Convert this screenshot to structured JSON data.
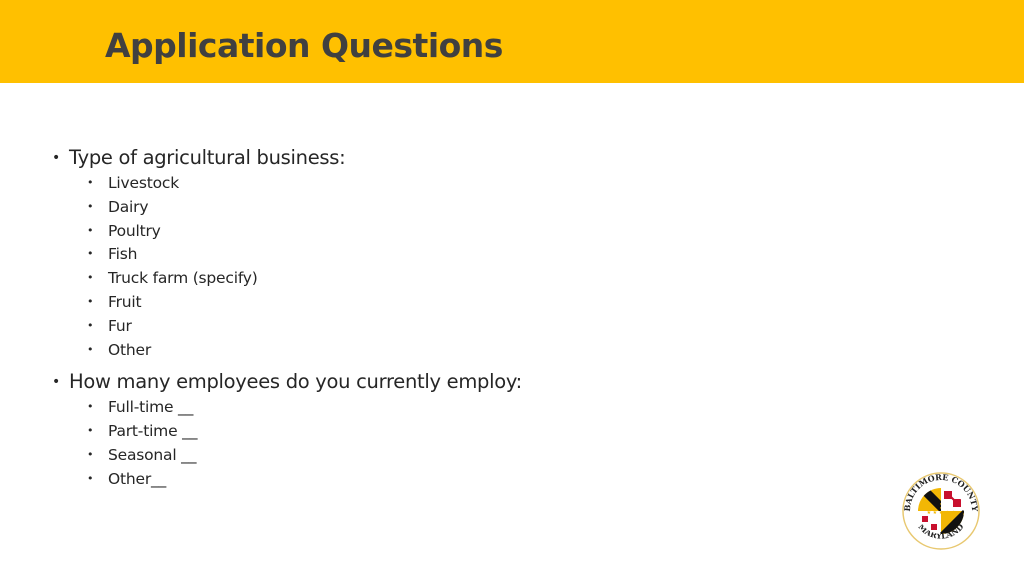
{
  "slide": {
    "title": "Application Questions",
    "colors": {
      "header_bg": "#ffc000",
      "title_text": "#404040",
      "body_text": "#262626"
    },
    "sections": [
      {
        "heading": "Type of agricultural business:",
        "items": [
          "Livestock",
          "Dairy",
          "Poultry",
          "Fish",
          "Truck farm (specify)",
          "Fruit",
          "Fur",
          "Other"
        ]
      },
      {
        "heading": "How many employees do you currently employ:",
        "items": [
          "Full-time __",
          "Part-time __",
          "Seasonal __",
          "Other__"
        ]
      }
    ],
    "bullet_glyph": "•",
    "logo": {
      "name": "baltimore-county-seal",
      "top_text": "BALTIMORE COUNTY",
      "bottom_text": "MARYLAND"
    }
  }
}
